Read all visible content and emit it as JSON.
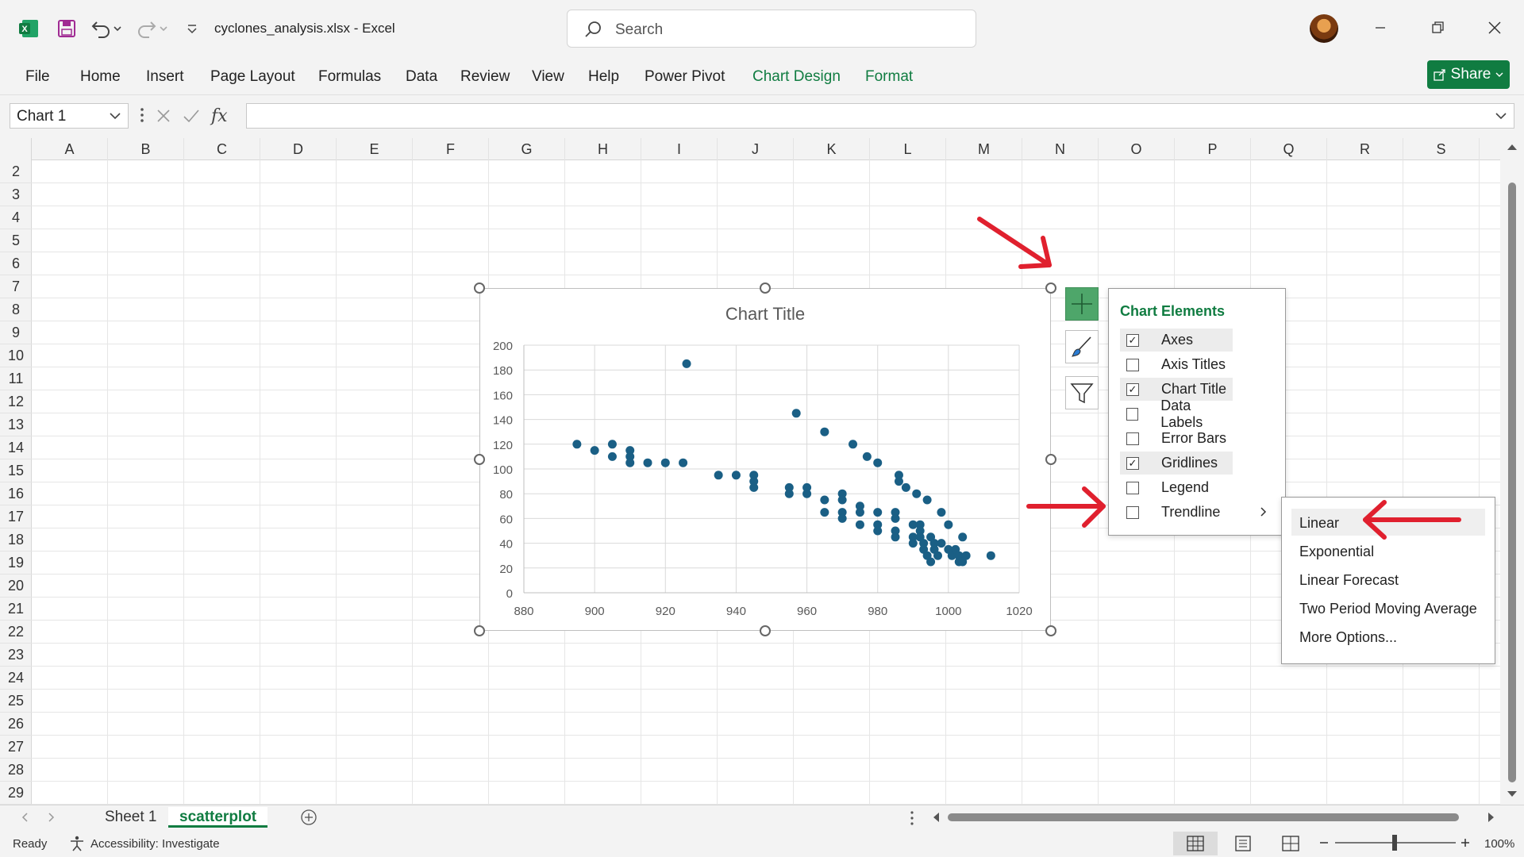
{
  "window": {
    "doc_title": "cyclones_analysis.xlsx  -  Excel",
    "search_placeholder": "Search"
  },
  "menu": {
    "items": [
      "File",
      "Home",
      "Insert",
      "Page Layout",
      "Formulas",
      "Data",
      "Review",
      "View",
      "Help",
      "Power Pivot"
    ],
    "contextual": [
      "Chart Design",
      "Format"
    ],
    "share_label": "Share"
  },
  "formula_bar": {
    "name_box": "Chart 1",
    "fx_label": "fx",
    "value": ""
  },
  "grid": {
    "columns": [
      "A",
      "B",
      "C",
      "D",
      "E",
      "F",
      "G",
      "H",
      "I",
      "J",
      "K",
      "L",
      "M",
      "N",
      "O",
      "P",
      "Q",
      "R",
      "S"
    ],
    "rows": [
      "2",
      "3",
      "4",
      "5",
      "6",
      "7",
      "8",
      "9",
      "10",
      "11",
      "12",
      "13",
      "14",
      "15",
      "16",
      "17",
      "18",
      "19",
      "20",
      "21",
      "22",
      "23",
      "24",
      "25",
      "26",
      "27",
      "28",
      "29"
    ]
  },
  "chart_data": {
    "type": "scatter",
    "title": "Chart Title",
    "xlabel": "",
    "ylabel": "",
    "xlim": [
      880,
      1020
    ],
    "ylim": [
      0,
      200
    ],
    "x_ticks": [
      880,
      900,
      920,
      940,
      960,
      980,
      1000,
      1020
    ],
    "y_ticks": [
      0,
      20,
      40,
      60,
      80,
      100,
      120,
      140,
      160,
      180,
      200
    ],
    "grid": true,
    "legend": "none",
    "marker_color": "#1a5f85",
    "points": [
      [
        895,
        120
      ],
      [
        900,
        115
      ],
      [
        905,
        120
      ],
      [
        905,
        110
      ],
      [
        910,
        115
      ],
      [
        910,
        110
      ],
      [
        910,
        105
      ],
      [
        915,
        105
      ],
      [
        920,
        105
      ],
      [
        925,
        105
      ],
      [
        926,
        185
      ],
      [
        935,
        95
      ],
      [
        940,
        95
      ],
      [
        945,
        95
      ],
      [
        945,
        90
      ],
      [
        945,
        85
      ],
      [
        955,
        85
      ],
      [
        955,
        80
      ],
      [
        957,
        145
      ],
      [
        960,
        85
      ],
      [
        960,
        80
      ],
      [
        965,
        130
      ],
      [
        965,
        75
      ],
      [
        965,
        65
      ],
      [
        970,
        80
      ],
      [
        970,
        75
      ],
      [
        970,
        65
      ],
      [
        970,
        60
      ],
      [
        973,
        120
      ],
      [
        975,
        70
      ],
      [
        975,
        65
      ],
      [
        975,
        55
      ],
      [
        977,
        110
      ],
      [
        980,
        105
      ],
      [
        980,
        65
      ],
      [
        980,
        55
      ],
      [
        980,
        50
      ],
      [
        985,
        65
      ],
      [
        985,
        60
      ],
      [
        985,
        50
      ],
      [
        985,
        45
      ],
      [
        986,
        95
      ],
      [
        986,
        90
      ],
      [
        988,
        85
      ],
      [
        990,
        55
      ],
      [
        990,
        45
      ],
      [
        990,
        40
      ],
      [
        991,
        80
      ],
      [
        992,
        55
      ],
      [
        992,
        50
      ],
      [
        992,
        45
      ],
      [
        993,
        40
      ],
      [
        993,
        35
      ],
      [
        994,
        75
      ],
      [
        994,
        30
      ],
      [
        995,
        45
      ],
      [
        995,
        25
      ],
      [
        996,
        40
      ],
      [
        996,
        35
      ],
      [
        997,
        30
      ],
      [
        998,
        65
      ],
      [
        998,
        40
      ],
      [
        1000,
        55
      ],
      [
        1000,
        35
      ],
      [
        1001,
        30
      ],
      [
        1002,
        35
      ],
      [
        1003,
        25
      ],
      [
        1003,
        30
      ],
      [
        1004,
        45
      ],
      [
        1004,
        25
      ],
      [
        1005,
        30
      ],
      [
        1012,
        30
      ]
    ]
  },
  "chart_elements": {
    "title": "Chart Elements",
    "items": [
      {
        "label": "Axes",
        "checked": true
      },
      {
        "label": "Axis Titles",
        "checked": false
      },
      {
        "label": "Chart Title",
        "checked": true
      },
      {
        "label": "Data Labels",
        "checked": false
      },
      {
        "label": "Error Bars",
        "checked": false
      },
      {
        "label": "Gridlines",
        "checked": true
      },
      {
        "label": "Legend",
        "checked": false
      },
      {
        "label": "Trendline",
        "checked": false
      }
    ]
  },
  "trendline_menu": [
    "Linear",
    "Exponential",
    "Linear Forecast",
    "Two Period Moving Average",
    "More Options..."
  ],
  "sheets": {
    "tabs": [
      "Sheet 1",
      "scatterplot"
    ],
    "active": "scatterplot"
  },
  "status": {
    "ready": "Ready",
    "accessibility": "Accessibility: Investigate",
    "zoom": "100%"
  },
  "colors": {
    "excel_green": "#107c41",
    "annotation_red": "#e0202e"
  }
}
